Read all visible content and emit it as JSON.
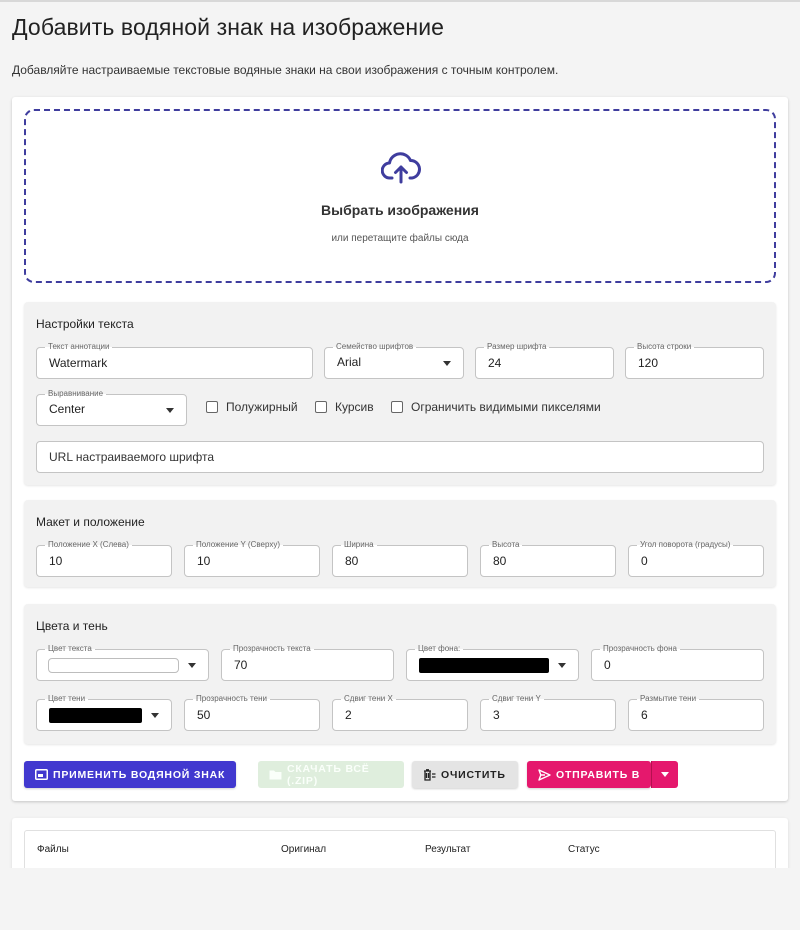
{
  "page": {
    "title": "Добавить водяной знак на изображение",
    "description": "Добавляйте настраиваемые текстовые водяные знаки на свои изображения с точным контролем."
  },
  "dropzone": {
    "title": "Выбрать изображения",
    "subtitle": "или перетащите файлы сюда",
    "icon": "cloud-upload-icon",
    "accent": "#3f3d9e"
  },
  "text_settings": {
    "title": "Настройки текста",
    "annotation": {
      "label": "Текст аннотации",
      "value": "Watermark"
    },
    "font_family": {
      "label": "Семейство шрифтов",
      "value": "Arial"
    },
    "font_size": {
      "label": "Размер шрифта",
      "value": "24"
    },
    "line_height": {
      "label": "Высота строки",
      "value": "120"
    },
    "alignment": {
      "label": "Выравнивание",
      "value": "Center"
    },
    "bold": {
      "label": "Полужирный",
      "checked": false
    },
    "italic": {
      "label": "Курсив",
      "checked": false
    },
    "clip": {
      "label": "Ограничить видимыми пикселями",
      "checked": false
    },
    "custom_font_url": {
      "placeholder": "URL настраиваемого шрифта"
    }
  },
  "layout": {
    "title": "Макет и положение",
    "pos_x": {
      "label": "Положение X (Слева)",
      "value": "10"
    },
    "pos_y": {
      "label": "Положение Y (Сверху)",
      "value": "10"
    },
    "width": {
      "label": "Ширина",
      "value": "80"
    },
    "height": {
      "label": "Высота",
      "value": "80"
    },
    "rotation": {
      "label": "Угол поворота (градусы)",
      "value": "0"
    }
  },
  "colors": {
    "title": "Цвета и тень",
    "text_color": {
      "label": "Цвет текста",
      "value": "#ffffff"
    },
    "text_opacity": {
      "label": "Прозрачность текста",
      "value": "70"
    },
    "bg_color": {
      "label": "Цвет фона:",
      "value": "#000000"
    },
    "bg_opacity": {
      "label": "Прозрачность фона",
      "value": "0"
    },
    "shadow_color": {
      "label": "Цвет тени",
      "value": "#000000"
    },
    "shadow_opacity": {
      "label": "Прозрачность тени",
      "value": "50"
    },
    "shadow_x": {
      "label": "Сдвиг тени X",
      "value": "2"
    },
    "shadow_y": {
      "label": "Сдвиг тени Y",
      "value": "3"
    },
    "shadow_blur": {
      "label": "Размытие тени",
      "value": "6"
    }
  },
  "actions": {
    "apply": "Применить водяной знак",
    "download": "Скачать всё (.zip)",
    "clear": "Очистить",
    "send": "Отправить в",
    "apply_color": "#4138cf",
    "send_color": "#e5186d"
  },
  "files_table": {
    "columns": [
      "Файлы",
      "Оригинал",
      "Результат",
      "Статус"
    ]
  }
}
